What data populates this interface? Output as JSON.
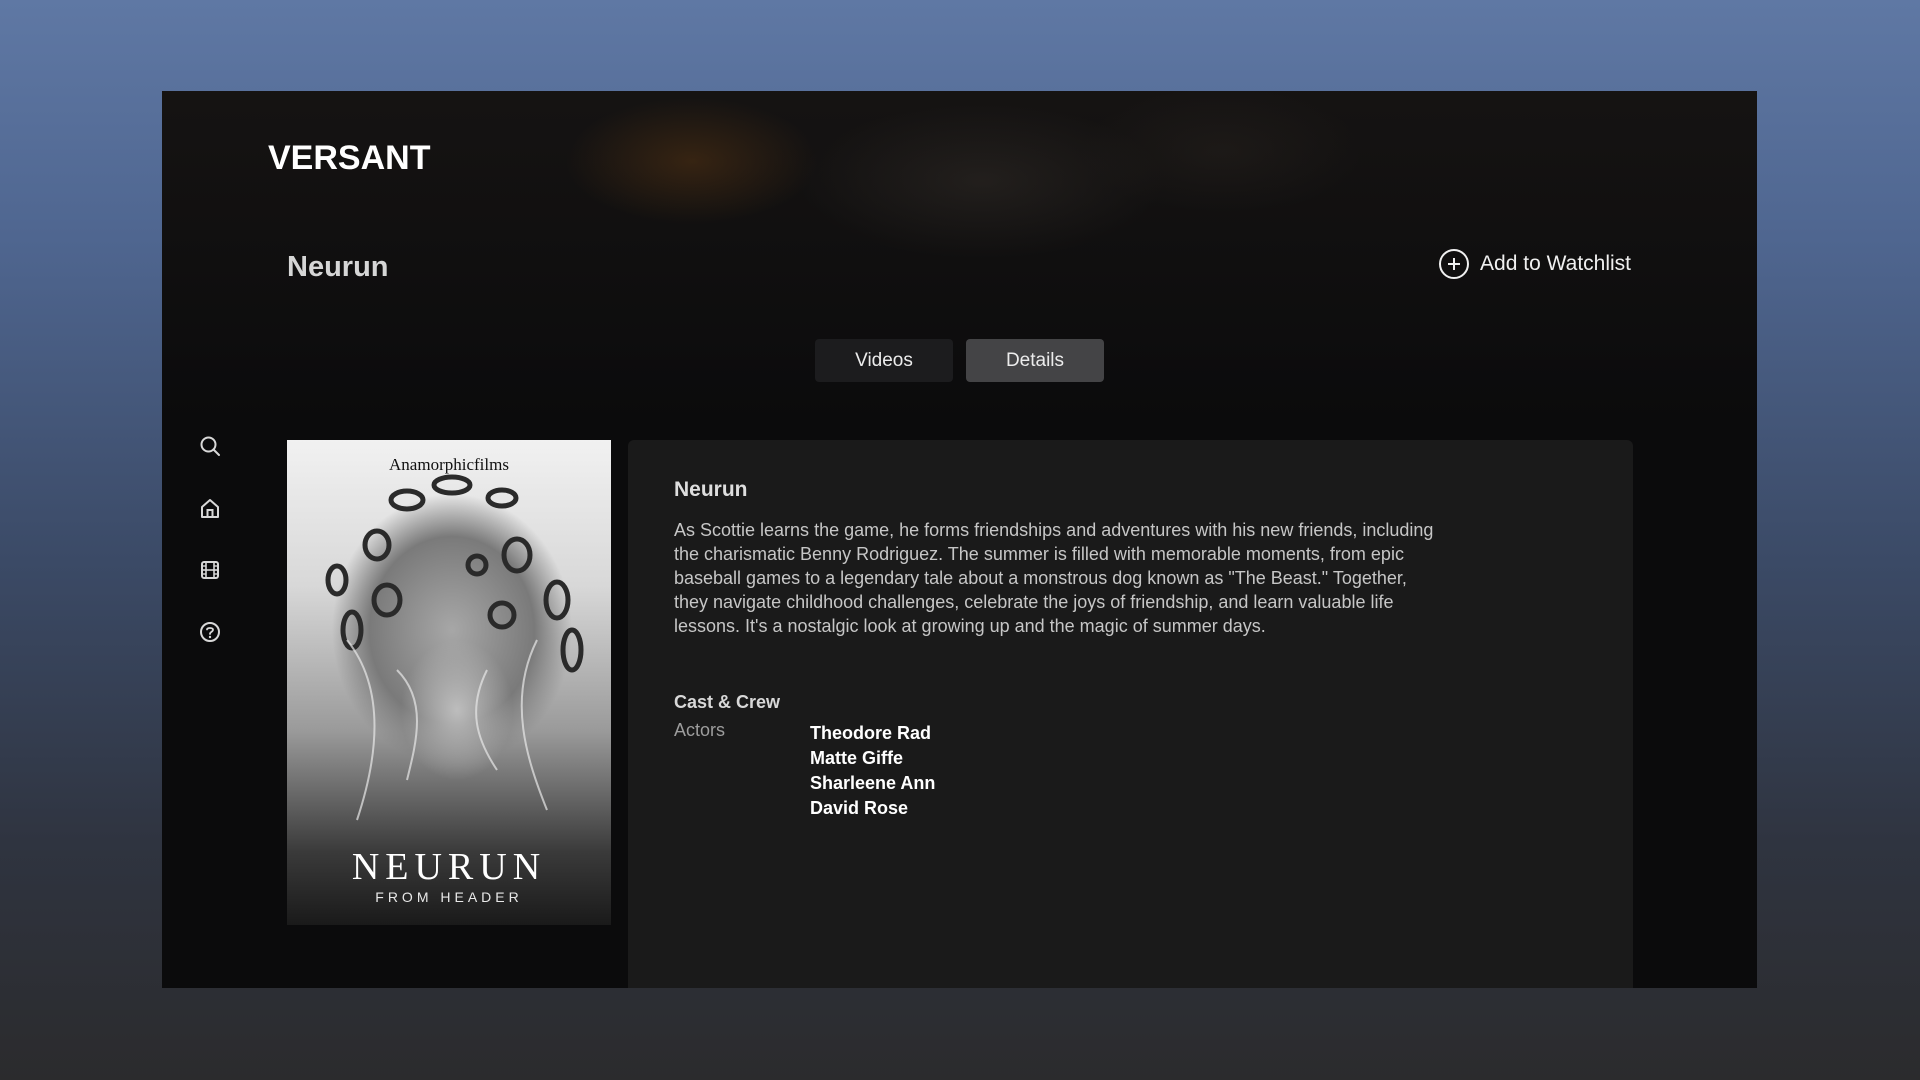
{
  "app": {
    "logo_text": "VERSANT"
  },
  "header": {
    "title": "Neurun",
    "watchlist_label": "Add to Watchlist",
    "watchlist_icon": "plus-circle-icon"
  },
  "tabs": [
    {
      "label": "Videos",
      "active": false
    },
    {
      "label": "Details",
      "active": true
    }
  ],
  "sidebar": {
    "items": [
      {
        "icon": "search-icon"
      },
      {
        "icon": "home-icon"
      },
      {
        "icon": "film-icon"
      },
      {
        "icon": "help-icon"
      }
    ]
  },
  "poster": {
    "studio": "Anamorphicfilms",
    "title": "NEURUN",
    "subtitle": "FROM HEADER"
  },
  "details": {
    "title": "Neurun",
    "synopsis": "As Scottie learns the game, he forms friendships and adventures with his new friends, including the charismatic Benny Rodriguez. The summer is filled with memorable moments, from epic baseball games to a legendary tale about a monstrous dog known as \"The Beast.\" Together, they navigate childhood challenges, celebrate the joys of friendship, and learn valuable life lessons. It's a nostalgic look at growing up and the magic of summer days.",
    "cast_heading": "Cast & Crew",
    "role_label": "Actors",
    "actors": [
      "Theodore Rad",
      "Matte Giffe",
      "Sharleene Ann",
      "David Rose"
    ]
  },
  "colors": {
    "panel": "#1a1a1a",
    "tab_active": "#444446",
    "tab_inactive": "#1c1c1e",
    "background": "#0b0b0c"
  }
}
